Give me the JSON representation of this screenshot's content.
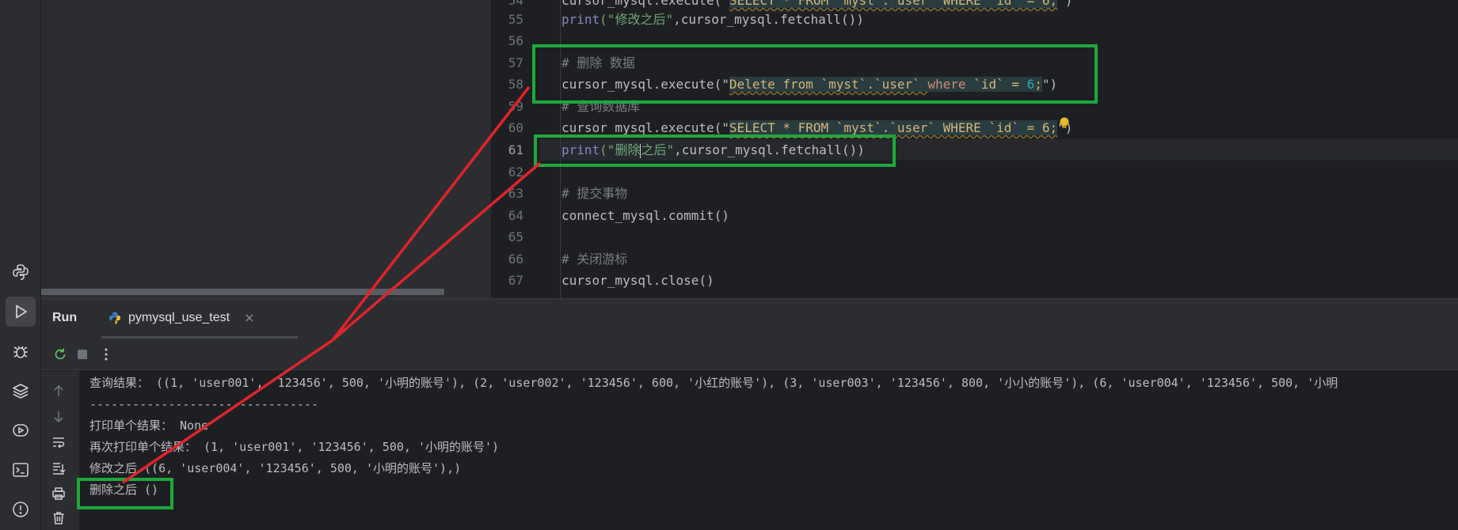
{
  "editor": {
    "lines": [
      {
        "n": "54",
        "partial": true
      },
      {
        "n": "55"
      },
      {
        "n": "56"
      },
      {
        "n": "57"
      },
      {
        "n": "58"
      },
      {
        "n": "59"
      },
      {
        "n": "60"
      },
      {
        "n": "61",
        "current": true
      },
      {
        "n": "62"
      },
      {
        "n": "63"
      },
      {
        "n": "64"
      },
      {
        "n": "65"
      },
      {
        "n": "66"
      },
      {
        "n": "67"
      }
    ],
    "code": {
      "l54_a": "cursor_mysql.execute(\"",
      "l54_b": "SELECT * FROM `myst`.`user` WHERE `id` = 6;",
      "l54_c": "\")",
      "l55_fn": "print",
      "l55_str": "(\"修改之后\"",
      "l55_rest": ",cursor_mysql.fetchall())",
      "l57": "# 删除 数据",
      "l58_a": "cursor_mysql.execute(\"",
      "l58_b1": "Delete from `myst`.`user` ",
      "l58_b2": "where",
      "l58_b3": " `id` = ",
      "l58_b4": "6",
      "l58_b5": ";",
      "l58_c": "\")",
      "l59": "# 查询数据库",
      "l60_a": "cursor_mysql.execute(\"",
      "l60_b": "SELECT * FROM `myst`.`user` WHERE `id` = 6;",
      "l60_c": "\")",
      "l61_fn": "print",
      "l61_str1": "(\"删除",
      "l61_str2": "之后\"",
      "l61_rest": ",cursor_mysql.fetchall())",
      "l63": "# 提交事物",
      "l64": "connect_mysql.commit()",
      "l66": "# 关闭游标",
      "l67": "cursor_mysql.close()"
    }
  },
  "run": {
    "title": "Run",
    "tab_label": "pymysql_use_test",
    "tab_close": "×",
    "output": [
      "查询结果： ((1, 'user001', '123456', 500, '小明的账号'), (2, 'user002', '123456', 600, '小红的账号'), (3, 'user003', '123456', 800, '小小的账号'), (6, 'user004', '123456', 500, '小明",
      "--------------------------------",
      "打印单个结果： None",
      "再次打印单个结果： (1, 'user001', '123456', 500, '小明的账号')",
      "修改之后 ((6, 'user004', '123456', 500, '小明的账号'),)",
      "删除之后 ()"
    ]
  },
  "icons": {
    "python_console": "python-console-icon",
    "run": "run-icon",
    "debug": "debug-icon",
    "layers": "layers-icon",
    "services": "services-icon",
    "terminal": "terminal-icon",
    "problems": "problems-icon"
  },
  "colors": {
    "annotation_box": "#1fa83b",
    "annotation_arrow": "#e0242b",
    "background": "#1e1f22",
    "panel": "#2b2d30"
  }
}
